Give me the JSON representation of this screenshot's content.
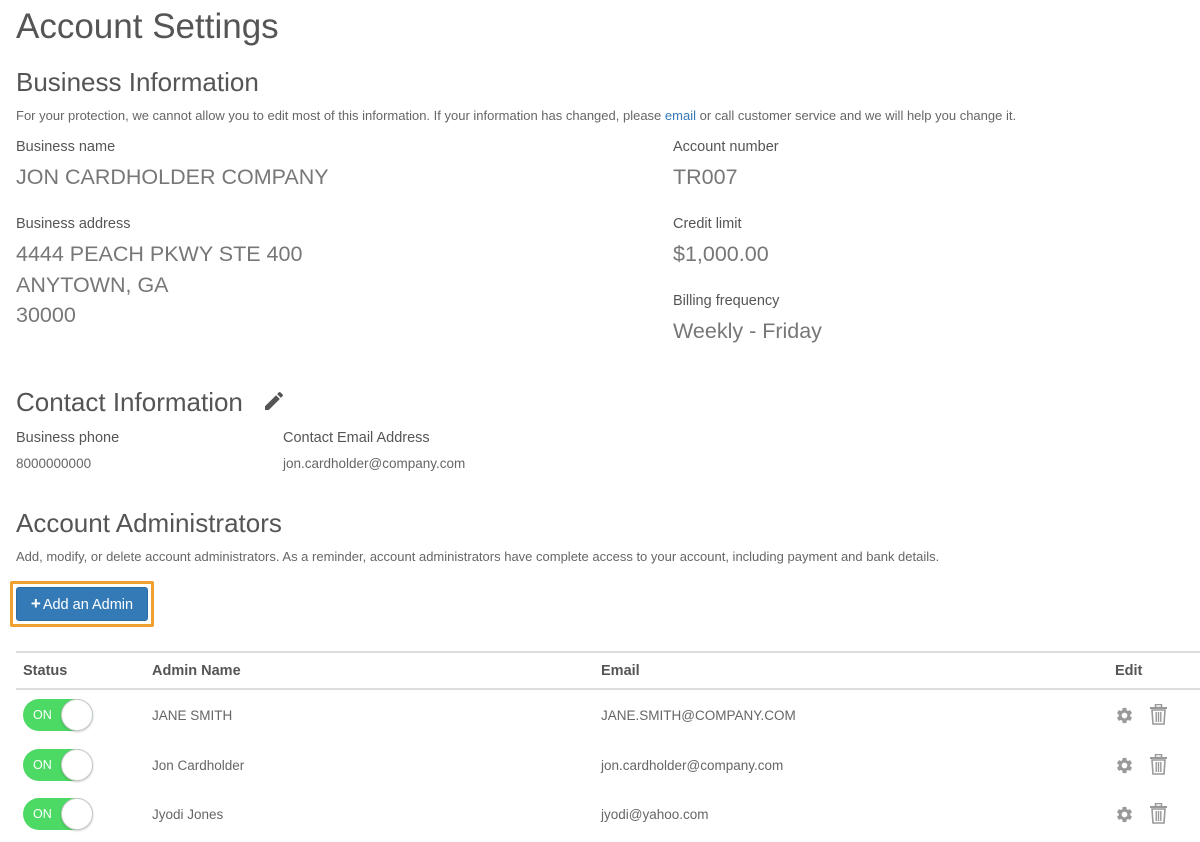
{
  "page": {
    "title": "Account Settings"
  },
  "business": {
    "heading": "Business Information",
    "notice_before": "For your protection, we cannot allow you to edit most of this information. If your information has changed, please ",
    "notice_link": "email",
    "notice_after": " or call customer service and we will help you change it.",
    "name_label": "Business name",
    "name_value": "JON CARDHOLDER COMPANY",
    "address_label": "Business address",
    "address_line1": "4444 PEACH PKWY STE 400",
    "address_line2": "ANYTOWN, GA",
    "address_line3": "30000",
    "account_label": "Account number",
    "account_value": "TR007",
    "credit_label": "Credit limit",
    "credit_value": "$1,000.00",
    "billing_label": "Billing frequency",
    "billing_value": "Weekly - Friday"
  },
  "contact": {
    "heading": "Contact Information",
    "edit_icon": "pencil-icon",
    "phone_label": "Business phone",
    "phone_value": "8000000000",
    "email_label": "Contact Email Address",
    "email_value": "jon.cardholder@company.com"
  },
  "admins": {
    "heading": "Account Administrators",
    "description": "Add, modify, or delete account administrators. As a reminder, account administrators have complete access to your account, including payment and bank details.",
    "add_button_icon": "+",
    "add_button_label": "Add an Admin",
    "columns": [
      "Status",
      "Admin Name",
      "Email",
      "Edit"
    ],
    "rows": [
      {
        "status": "ON",
        "name": "JANE SMITH",
        "email": "JANE.SMITH@COMPANY.COM"
      },
      {
        "status": "ON",
        "name": "Jon Cardholder",
        "email": "jon.cardholder@company.com"
      },
      {
        "status": "ON",
        "name": "Jyodi Jones",
        "email": "jyodi@yahoo.com"
      }
    ]
  },
  "colors": {
    "primary_button": "#337ab7",
    "toggle_on": "#4cd964",
    "focus_outline": "#f0a030",
    "link": "#337ab7"
  }
}
